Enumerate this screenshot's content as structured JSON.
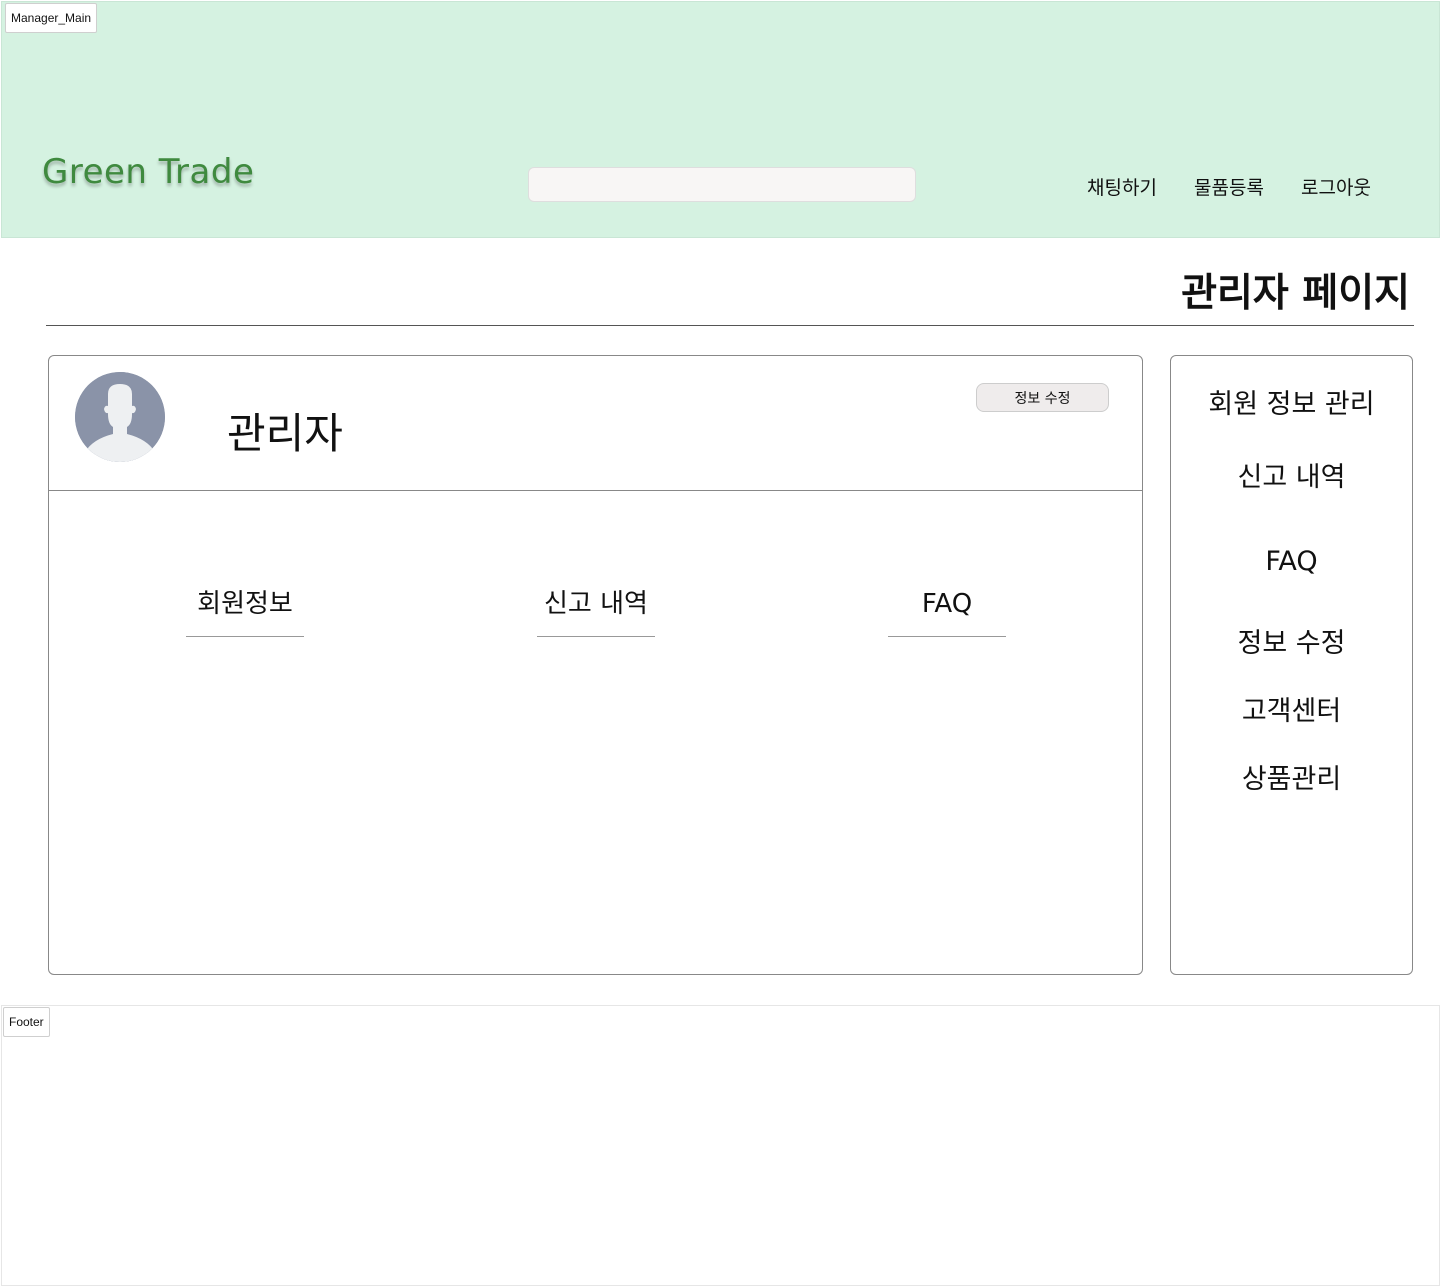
{
  "frame_label": "Manager_Main",
  "header": {
    "logo": "Green Trade",
    "search": {
      "value": "",
      "placeholder": ""
    },
    "nav": [
      "채팅하기",
      "물품등록",
      "로그아웃"
    ]
  },
  "page": {
    "title": "관리자 페이지"
  },
  "profile": {
    "name": "관리자",
    "avatar_icon": "user-avatar-icon",
    "edit_button": "정보 수정"
  },
  "card_tabs": [
    "회원정보",
    "신고 내역",
    "FAQ"
  ],
  "side_menu": [
    "회원 정보 관리",
    "신고 내역",
    "FAQ",
    "정보 수정",
    "고객센터",
    "상품관리"
  ],
  "footer_label": "Footer",
  "colors": {
    "header_bg": "#d5f2e1",
    "logo": "#3f8a3f",
    "avatar_bg": "#8a93a8"
  }
}
